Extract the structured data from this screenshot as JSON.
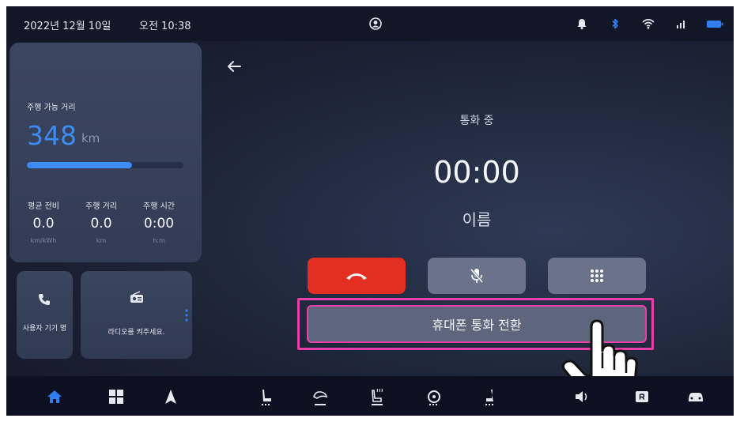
{
  "status_bar": {
    "date": "2022년 12월 10일",
    "time": "오전 10:38"
  },
  "trip": {
    "range_label": "주행 가능 거리",
    "range_value": "348",
    "range_unit": "km",
    "range_fill_percent": 67,
    "stats": [
      {
        "label": "평균 전비",
        "value": "0.0",
        "unit": "km/kWh"
      },
      {
        "label": "주행 거리",
        "value": "0.0",
        "unit": "km"
      },
      {
        "label": "주행 시간",
        "value": "0:00",
        "unit": "h:m"
      }
    ]
  },
  "tiles": {
    "user_device": "사용자 기기 명",
    "radio": "라디오를 켜주세요."
  },
  "call": {
    "status": "통화 중",
    "timer": "00:00",
    "caller_name": "이름",
    "transfer_label": "휴대폰 통화 전환"
  },
  "colors": {
    "accent": "#3d8cf5",
    "end_call": "#e32e22",
    "highlight": "#ea3fa6"
  }
}
